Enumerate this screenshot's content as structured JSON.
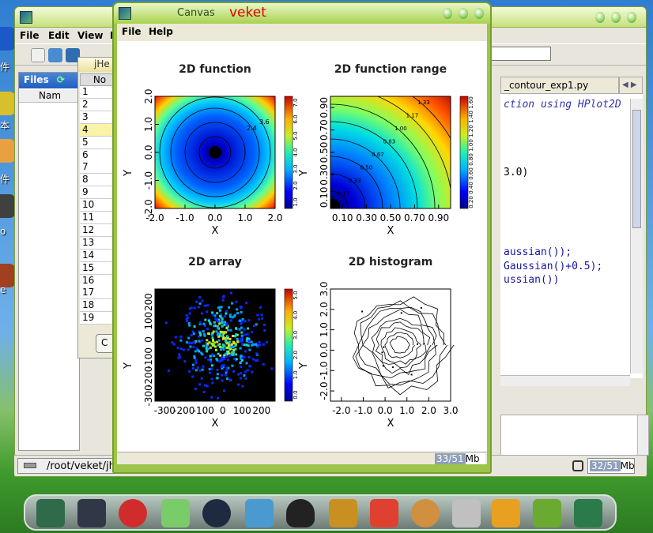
{
  "desktop": {
    "labels": [
      "件",
      "本",
      "件",
      "o",
      "e"
    ]
  },
  "editor": {
    "menu": {
      "file": "File",
      "edit": "Edit",
      "view": "View",
      "more": "F"
    },
    "files_tab": "Files",
    "files_column": "Nam",
    "code_tab": "_contour_exp1.py",
    "code_lines": [
      {
        "text": "ction using HPlot2D",
        "style": "it"
      },
      {
        "text": "3.0)",
        "style": "plain"
      },
      {
        "text": "aussian());",
        "style": "kw"
      },
      {
        "text": "Gaussian()+0.5);",
        "style": "kw"
      },
      {
        "text": "ussian())",
        "style": "kw"
      }
    ],
    "status_path": "/root/veket/jh",
    "memory": "32/51",
    "memory_unit": "Mb"
  },
  "jhep": {
    "title": "jHe",
    "column": "No",
    "rows": [
      "1",
      "2",
      "3",
      "4",
      "5",
      "6",
      "7",
      "8",
      "9",
      "10",
      "11",
      "12",
      "13",
      "14",
      "15",
      "16",
      "17",
      "18",
      "19"
    ],
    "selected_row": "4",
    "button_fragment": "C"
  },
  "canvas": {
    "title": "Canvas",
    "brand": "veket",
    "menu": {
      "file": "File",
      "help": "Help"
    },
    "memory": "33/51",
    "memory_unit": "Mb"
  },
  "chart_data": [
    {
      "type": "heatmap",
      "title": "2D function",
      "xlabel": "X",
      "ylabel": "Y",
      "xticks": [
        "-2.0",
        "-1.0",
        "0.0",
        "1.0",
        "2.0"
      ],
      "yticks": [
        "-2.0",
        "-1.0",
        "0.0",
        "1.0",
        "2.0"
      ],
      "xlim": [
        -2.0,
        2.0
      ],
      "ylim": [
        -2.0,
        2.0
      ],
      "contour_labels": [
        "2.4",
        "3.6"
      ],
      "colorbar_ticks": [
        "1.0",
        "2.0",
        "3.0",
        "4.0",
        "5.0",
        "6.0",
        "7.0"
      ]
    },
    {
      "type": "heatmap",
      "title": "2D function range",
      "xlabel": "X",
      "ylabel": "Y",
      "xticks": [
        "0.10",
        "0.30",
        "0.50",
        "0.70",
        "0.90"
      ],
      "yticks": [
        "0.10",
        "0.30",
        "0.50",
        "0.70",
        "0.90"
      ],
      "xlim": [
        0.0,
        1.0
      ],
      "ylim": [
        0.0,
        1.0
      ],
      "contour_labels": [
        "0.17",
        "0.33",
        "0.50",
        "0.67",
        "0.83",
        "1.00",
        "1.17",
        "1.33"
      ],
      "colorbar_ticks": [
        "0.20",
        "0.40",
        "0.60",
        "0.80",
        "1.00",
        "1.20",
        "1.40",
        "1.60"
      ]
    },
    {
      "type": "heatmap",
      "title": "2D array",
      "xlabel": "X",
      "ylabel": "Y",
      "xticks": [
        "-300",
        "-200",
        "-100",
        "0",
        "100",
        "200"
      ],
      "yticks": [
        "-300",
        "-200",
        "-100",
        "0",
        "100",
        "200"
      ],
      "xlim": [
        -350,
        270
      ],
      "ylim": [
        -330,
        270
      ],
      "colorbar_ticks": [
        "0.0",
        "1.0",
        "2.0",
        "3.0",
        "4.0",
        "5.0"
      ]
    },
    {
      "type": "contour",
      "title": "2D histogram",
      "xlabel": "X",
      "ylabel": "Y",
      "xticks": [
        "-2.0",
        "-1.0",
        "0.0",
        "1.0",
        "2.0",
        "3.0"
      ],
      "yticks": [
        "-2.0",
        "-1.0",
        "0.0",
        "1.0",
        "2.0",
        "3.0"
      ],
      "xlim": [
        -2.5,
        3.0
      ],
      "ylim": [
        -2.5,
        3.0
      ]
    }
  ]
}
